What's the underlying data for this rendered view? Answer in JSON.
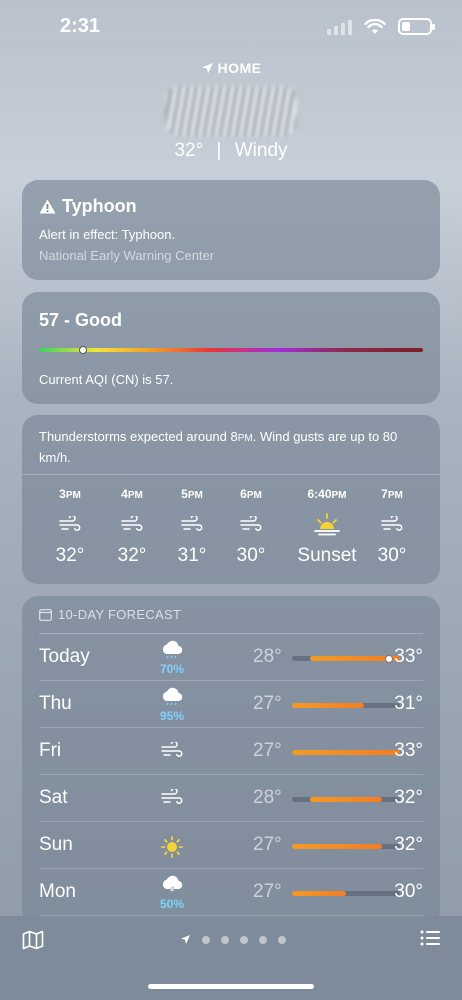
{
  "status_bar": {
    "time": "2:31"
  },
  "header": {
    "location_label": "HOME",
    "temperature": "32°",
    "separator": "|",
    "condition": "Windy"
  },
  "alert": {
    "title": "Typhoon",
    "text": "Alert in effect: Typhoon.",
    "source": "National Early Warning Center"
  },
  "aqi": {
    "title": "57 - Good",
    "text": "Current AQI (CN) is 57.",
    "value": 57,
    "scale_max": 500
  },
  "hourly": {
    "summary_main": "Thunderstorms expected around 8",
    "summary_pm": "PM",
    "summary_rest": ". Wind gusts are up to 80 km/h.",
    "items": [
      {
        "time": "3",
        "suffix": "PM",
        "icon": "wind-icon",
        "temp": "32°"
      },
      {
        "time": "4",
        "suffix": "PM",
        "icon": "wind-icon",
        "temp": "32°"
      },
      {
        "time": "5",
        "suffix": "PM",
        "icon": "wind-icon",
        "temp": "31°"
      },
      {
        "time": "6",
        "suffix": "PM",
        "icon": "wind-icon",
        "temp": "30°"
      },
      {
        "time": "6:40",
        "suffix": "PM",
        "icon": "sunset-icon",
        "temp": "Sunset"
      },
      {
        "time": "7",
        "suffix": "PM",
        "icon": "wind-icon",
        "temp": "30°"
      }
    ]
  },
  "forecast": {
    "header": "10-DAY FORECAST",
    "scale_min": 27,
    "scale_max": 33,
    "days": [
      {
        "day": "Today",
        "icon": "rain-cloud-icon",
        "prob": "70%",
        "low": "28°",
        "high": "33°",
        "low_val": 28,
        "high_val": 33
      },
      {
        "day": "Thu",
        "icon": "rain-cloud-icon",
        "prob": "95%",
        "low": "27°",
        "high": "31°",
        "low_val": 27,
        "high_val": 31
      },
      {
        "day": "Fri",
        "icon": "wind-icon",
        "prob": "",
        "low": "27°",
        "high": "33°",
        "low_val": 27,
        "high_val": 33
      },
      {
        "day": "Sat",
        "icon": "wind-icon",
        "prob": "",
        "low": "28°",
        "high": "32°",
        "low_val": 28,
        "high_val": 32
      },
      {
        "day": "Sun",
        "icon": "sun-icon",
        "prob": "",
        "low": "27°",
        "high": "32°",
        "low_val": 27,
        "high_val": 32
      },
      {
        "day": "Mon",
        "icon": "thunder-cloud-icon",
        "prob": "50%",
        "low": "27°",
        "high": "30°",
        "low_val": 27,
        "high_val": 30
      }
    ]
  },
  "bottom_bar": {
    "page_count": 5
  }
}
